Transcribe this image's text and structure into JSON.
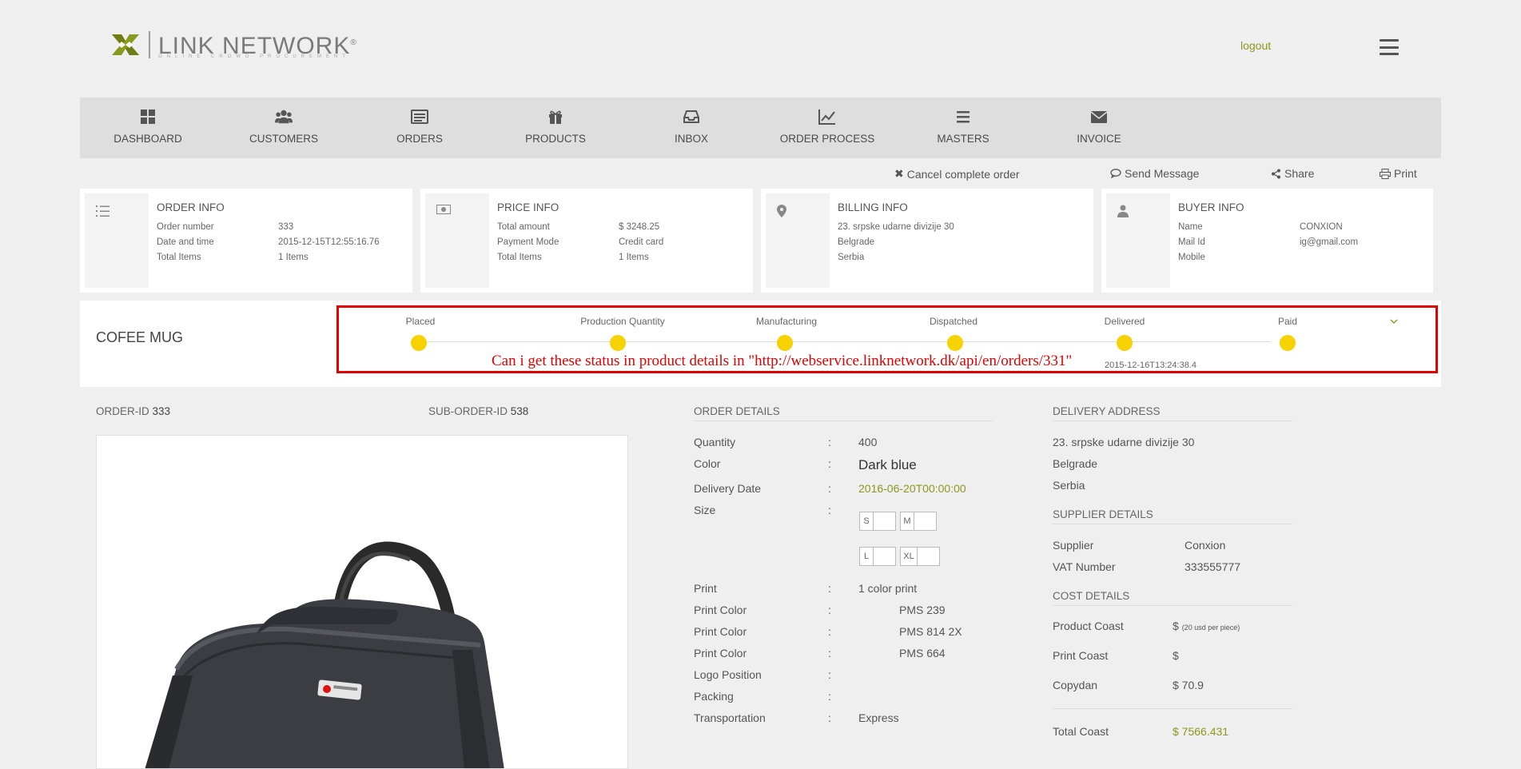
{
  "header": {
    "logo_text": "LINK NETWORK",
    "logo_reg": "®",
    "logo_sub": "ONLINE CROWD PROCUREMENT",
    "logout": "logout"
  },
  "nav": [
    {
      "label": "DASHBOARD",
      "icon": "dashboard-icon"
    },
    {
      "label": "CUSTOMERS",
      "icon": "users-icon"
    },
    {
      "label": "ORDERS",
      "icon": "orders-icon"
    },
    {
      "label": "PRODUCTS",
      "icon": "gift-icon"
    },
    {
      "label": "INBOX",
      "icon": "inbox-icon"
    },
    {
      "label": "ORDER PROCESS",
      "icon": "chart-line-icon"
    },
    {
      "label": "MASTERS",
      "icon": "list-icon"
    },
    {
      "label": "INVOICE",
      "icon": "envelope-icon"
    }
  ],
  "actions": {
    "cancel": "Cancel complete order",
    "send": "Send Message",
    "share": "Share",
    "print": "Print"
  },
  "order_info": {
    "title": "ORDER INFO",
    "rows": [
      {
        "label": "Order number",
        "value": "333"
      },
      {
        "label": "Date and time",
        "value": "2015-12-15T12:55:16.76"
      },
      {
        "label": "Total Items",
        "value": "1 Items"
      }
    ]
  },
  "price_info": {
    "title": "PRICE INFO",
    "rows": [
      {
        "label": "Total amount",
        "value": "$ 3248.25"
      },
      {
        "label": "Payment Mode",
        "value": "Credit card"
      },
      {
        "label": "Total Items",
        "value": "1 Items"
      }
    ]
  },
  "billing_info": {
    "title": "BILLING INFO",
    "lines": [
      "23. srpske udarne divizije 30",
      "Belgrade",
      "Serbia"
    ]
  },
  "buyer_info": {
    "title": "BUYER INFO",
    "rows": [
      {
        "label": "Name",
        "value": "CONXION"
      },
      {
        "label": "Mail Id",
        "value": "ig@gmail.com"
      },
      {
        "label": "Mobile",
        "value": ""
      }
    ]
  },
  "product": {
    "title": "COFEE MUG"
  },
  "statuses": [
    "Placed",
    "Production Quantity",
    "Manufacturing",
    "Dispatched",
    "Delivered",
    "Paid"
  ],
  "status_time": "2015-12-16T13:24:38.4",
  "annotation": "Can i get these status in product details in \"http://webservice.linknetwork.dk/api/en/orders/331\"",
  "ids": {
    "order_label": "ORDER-ID",
    "order_value": "333",
    "sub_label": "SUB-ORDER-ID",
    "sub_value": "538"
  },
  "order_details": {
    "title": "ORDER DETAILS",
    "colon": ":",
    "quantity_label": "Quantity",
    "quantity": "400",
    "color_label": "Color",
    "color": "Dark blue",
    "delivery_label": "Delivery Date",
    "delivery": "2016-06-20T00:00:00",
    "size_label": "Size",
    "sizes": [
      "S",
      "M",
      "L",
      "XL"
    ],
    "print_label": "Print",
    "print": "1 color print",
    "print_color_label": "Print Color",
    "print_colors": [
      "PMS 239",
      "PMS 814 2X",
      "PMS 664"
    ],
    "logo_label": "Logo Position",
    "packing_label": "Packing",
    "transport_label": "Transportation",
    "transport": "Express"
  },
  "delivery_address": {
    "title": "DELIVERY ADDRESS",
    "lines": [
      "23. srpske udarne divizije 30",
      "Belgrade",
      "Serbia"
    ]
  },
  "supplier": {
    "title": "SUPPLIER DETAILS",
    "supplier_label": "Supplier",
    "supplier": "Conxion",
    "vat_label": "VAT Number",
    "vat": "333555777"
  },
  "cost": {
    "title": "COST DETAILS",
    "product_label": "Product Coast",
    "product_value": "$",
    "product_note": "(20 usd per piece)",
    "print_label": "Print Coast",
    "print_value": "$",
    "copydan_label": "Copydan",
    "copydan_value": "$ 70.9",
    "total_label": "Total Coast",
    "total_value": "$ 7566.431"
  },
  "colors": {
    "accent": "#8a9a1c",
    "status_dot": "#f5d200",
    "annotation": "#e30000"
  }
}
